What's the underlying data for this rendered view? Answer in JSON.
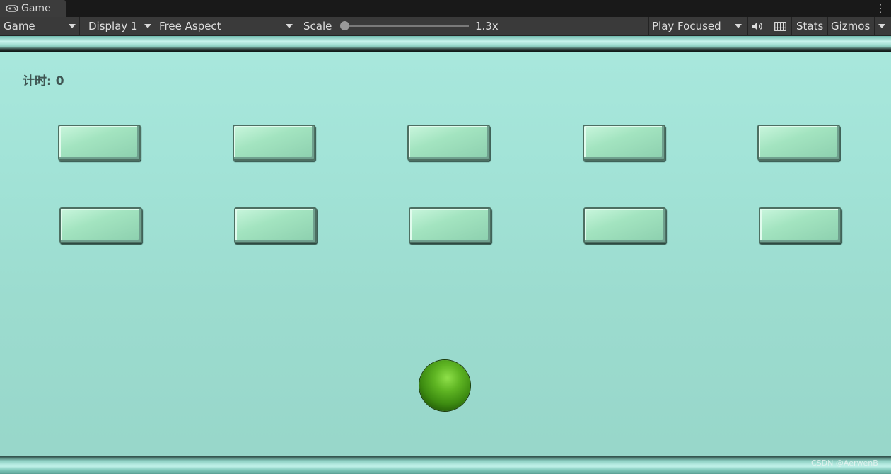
{
  "tab": {
    "icon": "gamepad-icon",
    "label": "Game"
  },
  "toolbar": {
    "mode": "Game",
    "display": "Display 1",
    "aspect": "Free Aspect",
    "scale_label": "Scale",
    "scale_value": "1.3x",
    "scale_fraction": 0.0,
    "play_mode": "Play Focused",
    "mute_icon": "speaker-icon",
    "keyboard_icon": "keyboard-icon",
    "stats": "Stats",
    "gizmos": "Gizmos"
  },
  "game": {
    "timer_text": "计时: 0",
    "brick_rows": 2,
    "bricks_per_row": 5,
    "colors": {
      "background": "#a2e3d7",
      "brick": "#a3e4c0",
      "ball": "#4a9e18"
    }
  },
  "watermark": "CSDN @AerwenB"
}
